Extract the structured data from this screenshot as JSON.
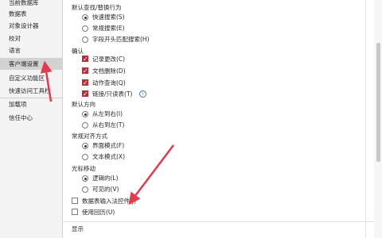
{
  "sidebar": {
    "items": [
      {
        "label": "当前数据库"
      },
      {
        "label": "数据表"
      },
      {
        "label": "对象设计器"
      },
      {
        "label": "校对"
      },
      {
        "label": "语言"
      },
      {
        "label": "客户端设置"
      },
      {
        "label": "自定义功能区"
      },
      {
        "label": "快速访问工具栏"
      },
      {
        "label": "加载项"
      },
      {
        "label": "信任中心"
      }
    ]
  },
  "main": {
    "find_replace": {
      "title": "默认查找/替换行为",
      "options": [
        "快速搜索(S)",
        "常规搜索(E)",
        "字段开头匹配搜索(H)"
      ],
      "selected": 0
    },
    "confirm": {
      "title": "确认",
      "options": [
        "记录更改(C)",
        "文档删除(D)",
        "动作查询(Q)",
        "链接/只读表(T)"
      ],
      "checked": [
        true,
        true,
        true,
        true
      ]
    },
    "direction": {
      "title": "默认方向",
      "options": [
        "从左到右(I)",
        "从右到左(T)"
      ],
      "selected": 0
    },
    "align": {
      "title": "常规对齐方式",
      "options": [
        "界面模式(F)",
        "文本模式(X)"
      ],
      "selected": 0
    },
    "cursor": {
      "title": "光标移动",
      "options": [
        "逻辑的(L)",
        "可见的(V)"
      ],
      "selected": 0
    },
    "misc": {
      "options": [
        "数据表输入法控件(J)",
        "使用回历(U)"
      ],
      "checked": [
        false,
        false
      ]
    },
    "display": {
      "title": "显示"
    }
  },
  "colors": {
    "accent": "#b3323a",
    "arrow": "#e23a4f",
    "sidebar_bg": "#f3f3f3",
    "active_bg": "#d2d2d2"
  },
  "icons": {
    "info": "info-icon"
  }
}
